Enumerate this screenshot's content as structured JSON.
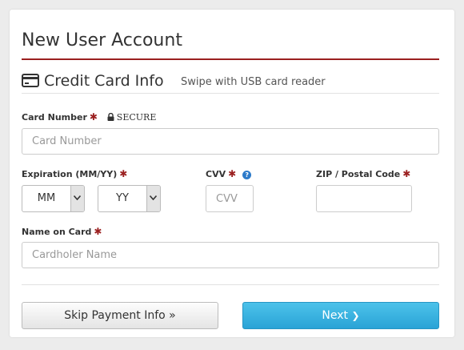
{
  "page": {
    "title": "New User Account"
  },
  "section": {
    "title": "Credit Card Info",
    "subtitle": "Swipe with USB card reader"
  },
  "card_number": {
    "label": "Card Number",
    "required_mark": "✱",
    "secure_text": "SECURE",
    "placeholder": "Card Number"
  },
  "expiration": {
    "label": "Expiration (MM/YY)",
    "required_mark": "✱",
    "month_value": "MM",
    "year_value": "YY"
  },
  "cvv": {
    "label": "CVV",
    "required_mark": "✱",
    "help_glyph": "?",
    "placeholder": "CVV"
  },
  "zip": {
    "label": "ZIP / Postal Code",
    "required_mark": "✱",
    "placeholder": ""
  },
  "name_on_card": {
    "label": "Name on Card",
    "required_mark": "✱",
    "placeholder": "Cardholer Name"
  },
  "buttons": {
    "skip_label": "Skip Payment Info",
    "skip_glyph": "»",
    "next_label": "Next",
    "next_glyph": "❯"
  },
  "colors": {
    "accent": "#9b2020",
    "primary_button": "#2aa3d6",
    "help": "#2c7ac9"
  },
  "icons": [
    "credit-card-icon",
    "lock-icon",
    "help-icon",
    "chevron-down-icon",
    "double-chevron-right-icon",
    "chevron-right-icon"
  ]
}
